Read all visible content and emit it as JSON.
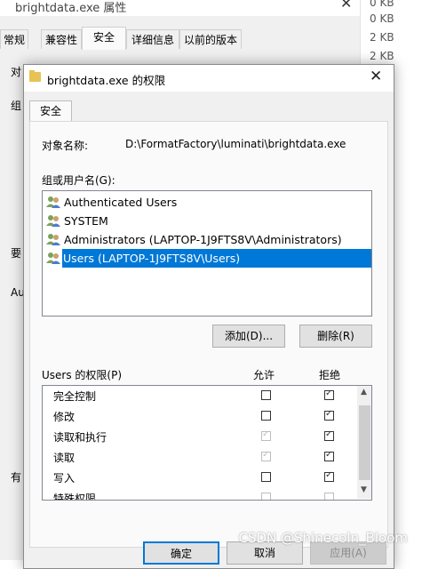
{
  "background_window": {
    "title": "brightdata.exe 属性",
    "tabs": [
      "常规",
      "兼容性",
      "安全",
      "详细信息",
      "以前的版本"
    ],
    "active_tab": "安全",
    "side_texts": [
      "对",
      "组",
      "要",
      "Au",
      "有"
    ]
  },
  "file_list_sizes": [
    "0 KB",
    "0 KB",
    "2 KB",
    "2 KB"
  ],
  "dialog": {
    "title": "brightdata.exe 的权限",
    "close_symbol": "✕",
    "tab": "安全",
    "object_label": "对象名称:",
    "object_value": "D:\\FormatFactory\\luminati\\brightdata.exe",
    "group_label": "组或用户名(G):",
    "users": [
      {
        "name": "Authenticated Users",
        "selected": false
      },
      {
        "name": "SYSTEM",
        "selected": false
      },
      {
        "name": "Administrators (LAPTOP-1J9FTS8V\\Administrators)",
        "selected": false
      },
      {
        "name": "Users (LAPTOP-1J9FTS8V\\Users)",
        "selected": true
      }
    ],
    "add_button": "添加(D)...",
    "remove_button": "删除(R)",
    "permissions_label": "Users 的权限(P)",
    "allow_header": "允许",
    "deny_header": "拒绝",
    "permissions": [
      {
        "name": "完全控制",
        "allow": false,
        "allow_inherited": false,
        "deny": true
      },
      {
        "name": "修改",
        "allow": false,
        "allow_inherited": false,
        "deny": true
      },
      {
        "name": "读取和执行",
        "allow": true,
        "allow_inherited": true,
        "deny": true
      },
      {
        "name": "读取",
        "allow": true,
        "allow_inherited": true,
        "deny": true
      },
      {
        "name": "写入",
        "allow": false,
        "allow_inherited": false,
        "deny": true
      },
      {
        "name": "特殊权限",
        "allow": false,
        "allow_inherited": false,
        "deny": false
      }
    ],
    "ok_button": "确定",
    "cancel_button": "取消",
    "apply_button": "应用(A)"
  },
  "watermark": "CSDN @Shinecoln_Bloom",
  "colors": {
    "selection": "#0078d7",
    "folder_icon": "#e8c252"
  }
}
